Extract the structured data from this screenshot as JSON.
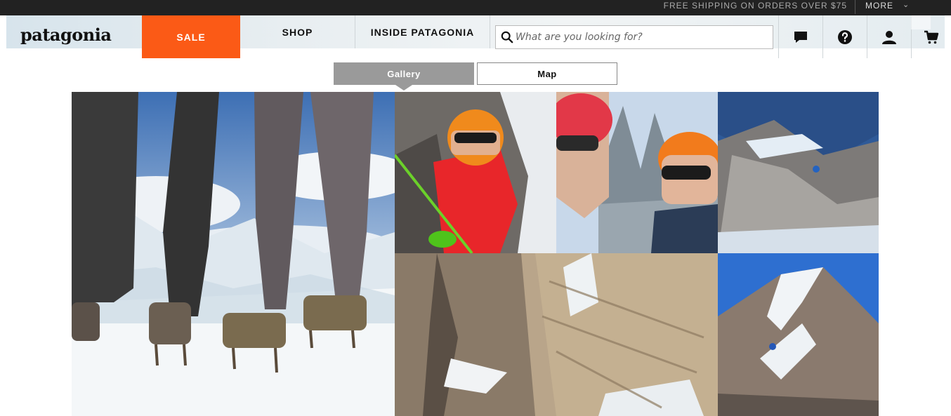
{
  "promo": {
    "shipping_text": "FREE SHIPPING ON ORDERS OVER $75",
    "more_label": "MORE"
  },
  "header": {
    "logo": "patagonia",
    "nav": {
      "sale": "SALE",
      "shop": "SHOP",
      "inside": "INSIDE PATAGONIA"
    },
    "search": {
      "placeholder": "What are you looking for?",
      "value": ""
    }
  },
  "tabs": {
    "gallery": "Gallery",
    "map": "Map",
    "active": "Gallery"
  },
  "colors": {
    "sale_bg": "#fb5a16",
    "topbar_bg": "#222222",
    "active_tab_bg": "#9a9a9a"
  },
  "icons": [
    "search-icon",
    "chat-icon",
    "help-icon",
    "account-icon",
    "cart-icon",
    "chevron-down-icon"
  ],
  "gallery": {
    "tiles": [
      {
        "subject": "legs-with-crampons-on-glacier"
      },
      {
        "subject": "climber-orange-helmet-red-jacket"
      },
      {
        "subject": "two-climbers-selfie-mountains"
      },
      {
        "subject": "climber-on-rocky-snowy-ridge"
      },
      {
        "subject": "granite-wall-with-snow"
      },
      {
        "subject": "climber-on-snowy-peak"
      }
    ]
  }
}
